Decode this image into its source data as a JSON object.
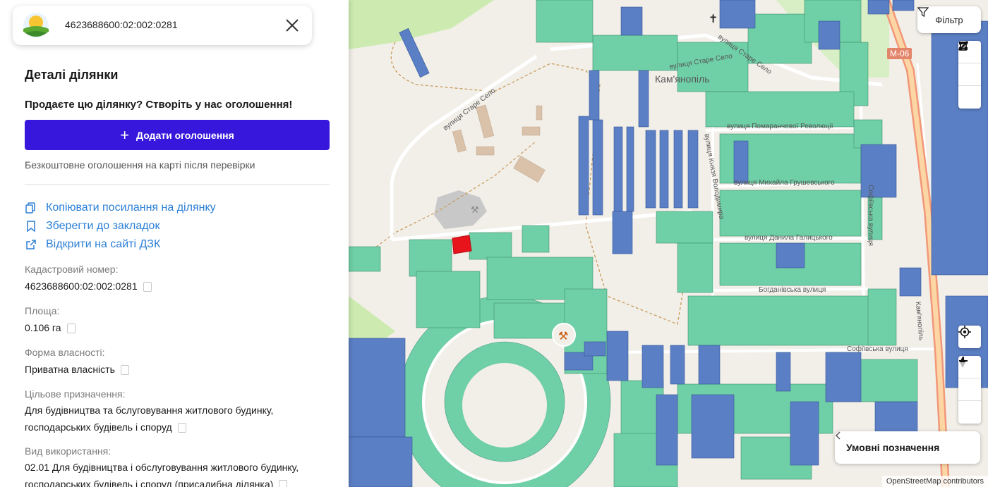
{
  "search": {
    "cadastral_query": "4623688600:02:002:0281"
  },
  "panel": {
    "title": "Деталі ділянки",
    "promo": "Продаєте цю ділянку? Створіть у нас оголошення!",
    "add_button": "Додати оголошення",
    "note": "Безкоштовне оголошення на карті після перевірки",
    "links": {
      "copy": "Копіювати посилання на ділянку",
      "bookmark": "Зберегти до закладок",
      "open_dzk": "Відкрити на сайті ДЗК"
    },
    "fields": {
      "cadastral_label": "Кадастровий номер:",
      "cadastral_value": "4623688600:02:002:0281",
      "area_label": "Площа:",
      "area_value": "0.106 га",
      "ownership_label": "Форма власності:",
      "ownership_value": "Приватна власність",
      "purpose_label": "Цільове призначення:",
      "purpose_value": "Для будівництва та бслуговування житлового будинку, господарських будівель і споруд",
      "usage_label": "Вид використання:",
      "usage_value": "02.01 Для будівництва і обслуговування житлового будинку, господарських будівель і споруд (присадибна ділянка)"
    }
  },
  "map": {
    "filter_button": "Фільтр",
    "legend_button": "Умовні позначення",
    "attribution": "OpenStreetMap contributors",
    "labels": {
      "village": "Кам'янопіль",
      "road_m06": "М-06",
      "street_stare_selo_1": "вулиця Старе Село",
      "street_stare_selo_2": "вулиця Старе Село",
      "street_stare_selo_3": "вулиця Старе Село",
      "street_pomarancheva": "вулиця Помаранчевої Революції",
      "street_knyazya": "вулиця Князя Володимира",
      "street_hrushevskoho": "вулиця Михайла Грушевського",
      "street_halytskoho": "вулиця Данила Галицького",
      "street_bohdanivska": "Богданівська вулиця",
      "street_sofiivska_h": "Софіївська вулиця",
      "street_sofiivska_v": "Софіївська вулиця",
      "street_kamianopil": "Кам'янопіль"
    },
    "colors": {
      "parcel_green": "#6fcfa6",
      "parcel_blue": "#5b7fc4",
      "selected_parcel": "#e8141c",
      "accent": "#3617db"
    }
  }
}
